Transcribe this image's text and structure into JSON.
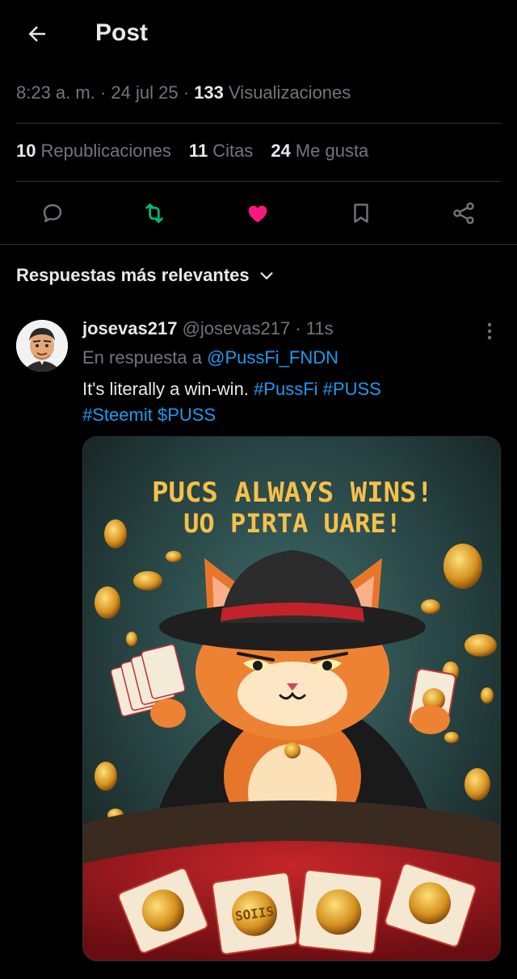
{
  "header": {
    "title": "Post"
  },
  "meta": {
    "time": "8:23 a. m.",
    "date": "24 jul 25",
    "views_count": "133",
    "views_label": "Visualizaciones"
  },
  "stats": [
    {
      "count": "10",
      "label": "Republicaciones"
    },
    {
      "count": "11",
      "label": "Citas"
    },
    {
      "count": "24",
      "label": "Me gusta"
    }
  ],
  "actions": [
    {
      "icon": "reply-icon",
      "color": "#71767b"
    },
    {
      "icon": "repost-icon",
      "color": "#00ba7c"
    },
    {
      "icon": "heart-icon",
      "color": "#f91880"
    },
    {
      "icon": "bookmark-icon",
      "color": "#71767b"
    },
    {
      "icon": "share-icon",
      "color": "#71767b"
    }
  ],
  "sort": {
    "label": "Respuestas más relevantes"
  },
  "reply": {
    "name": "josevas217",
    "handle": "@josevas217",
    "time": "11s",
    "in_reply_prefix": "En respuesta a",
    "in_reply_to": "@PussFi_FNDN",
    "text": "It's literally a win-win.",
    "tags": [
      "#PussFi",
      "#PUSS",
      "#Steemit",
      "$PUSS"
    ],
    "image": {
      "title_line1": "PUCS ALWAYS WINS!",
      "title_line2": "UO PIRTA UARE!",
      "card_text": "SOIIS"
    }
  },
  "colors": {
    "accent": "#1d9bf0",
    "like": "#f91880",
    "repost": "#00ba7c",
    "muted": "#71767b"
  }
}
